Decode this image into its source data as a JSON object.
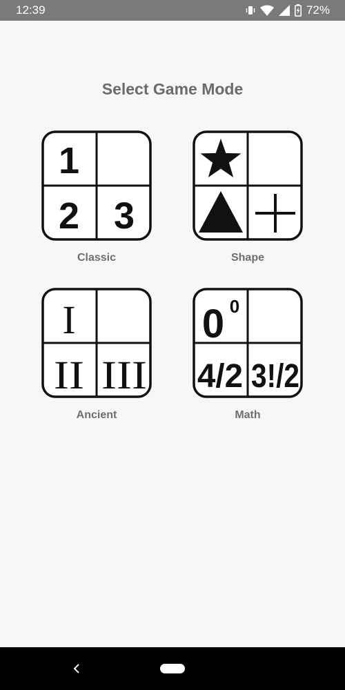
{
  "status_bar": {
    "time": "12:39",
    "battery": "72%",
    "icons": [
      "vibrate-icon",
      "wifi-icon",
      "signal-icon",
      "battery-icon"
    ]
  },
  "title": "Select Game Mode",
  "modes": [
    {
      "label": "Classic",
      "tiles": [
        "1",
        "",
        "2",
        "3"
      ]
    },
    {
      "label": "Shape",
      "tiles": [
        "star-icon",
        "",
        "triangle-icon",
        "plus-icon"
      ]
    },
    {
      "label": "Ancient",
      "tiles": [
        "I",
        "",
        "II",
        "III"
      ]
    },
    {
      "label": "Math",
      "tiles": [
        "0",
        "0",
        "4/2",
        "3!/2"
      ]
    }
  ],
  "nav_bar": {
    "icons": [
      "back-icon",
      "home-pill"
    ]
  },
  "colors": {
    "background": "#f8f6f8",
    "status_bar": "#7a7a7a",
    "text": "#6b6b6b",
    "tile_border": "#111111",
    "nav_bar": "#000000"
  }
}
